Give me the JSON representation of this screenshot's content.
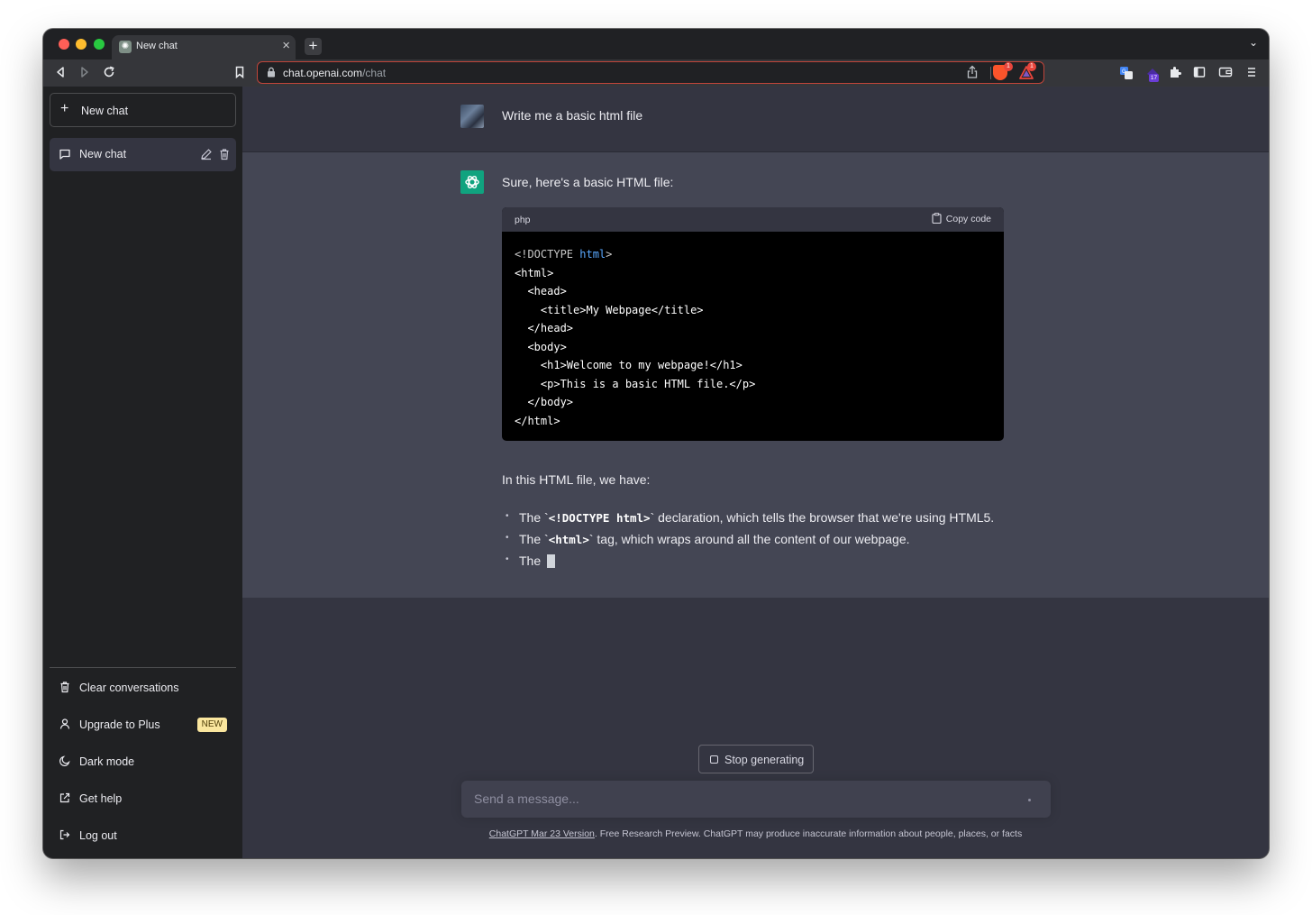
{
  "browser": {
    "tab_title": "New chat",
    "tab_close_glyph": "×",
    "new_tab_glyph": "+",
    "tab_list_glyph": "⌄",
    "url_host": "chat.openai.com",
    "url_path": "/chat",
    "shield_count": "1",
    "rewards_count": "1",
    "extension_badge": "17"
  },
  "sidebar": {
    "new_chat_label": "New chat",
    "conversation_label": "New chat",
    "bottom_items": [
      {
        "label": "Clear conversations",
        "icon": "trash-icon"
      },
      {
        "label": "Upgrade to Plus",
        "icon": "user-icon",
        "badge": "NEW"
      },
      {
        "label": "Dark mode",
        "icon": "moon-icon"
      },
      {
        "label": "Get help",
        "icon": "external-link-icon"
      },
      {
        "label": "Log out",
        "icon": "logout-icon"
      }
    ]
  },
  "thread": {
    "user_message": "Write me a basic html file",
    "assistant_intro": "Sure, here's a basic HTML file:",
    "code_lang": "php",
    "copy_label": "Copy code",
    "code_lines": [
      "<!DOCTYPE html>",
      "<html>",
      "  <head>",
      "    <title>My Webpage</title>",
      "  </head>",
      "  <body>",
      "    <h1>Welcome to my webpage!</h1>",
      "    <p>This is a basic HTML file.</p>",
      "  </body>",
      "</html>"
    ],
    "explain": "In this HTML file, we have:",
    "bullets": [
      {
        "pre": "The `",
        "code": "<!DOCTYPE html>",
        "post": "` declaration, which tells the browser that we're using HTML5."
      },
      {
        "pre": "The `",
        "code": "<html>",
        "post": "` tag, which wraps around all the content of our webpage."
      },
      {
        "pre": "The ",
        "code": "",
        "post": ""
      }
    ]
  },
  "composer": {
    "stop_label": "Stop generating",
    "placeholder": "Send a message...",
    "footer_link": "ChatGPT Mar 23 Version",
    "footer_text": ". Free Research Preview. ChatGPT may produce inaccurate information about people, places, or facts"
  },
  "colors": {
    "sidebar_bg": "#202123",
    "main_bg": "#343541",
    "assistant_bg": "#444654",
    "openai_green": "#10a37f",
    "new_badge_bg": "#fae69e"
  }
}
